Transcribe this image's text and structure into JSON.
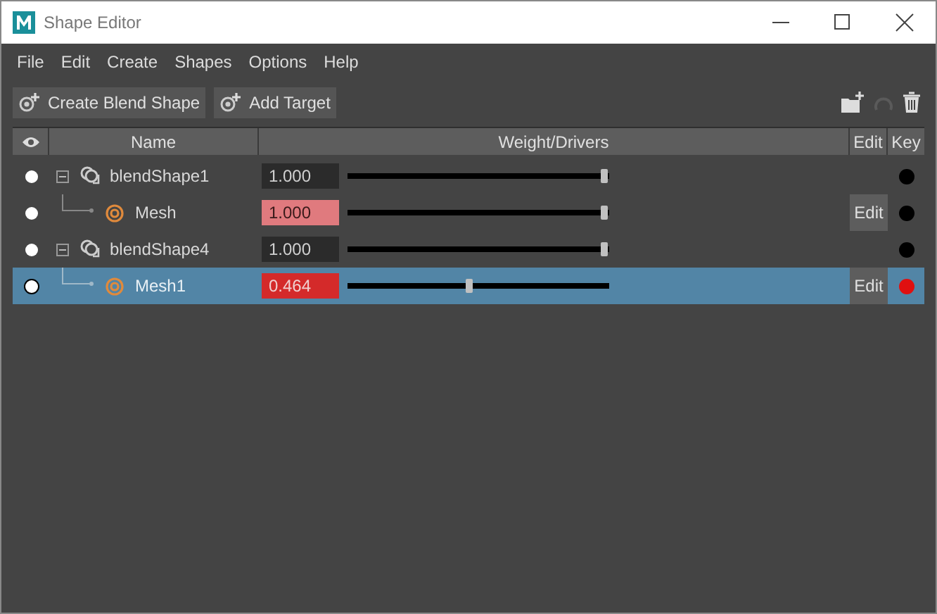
{
  "window": {
    "title": "Shape Editor"
  },
  "menu": [
    "File",
    "Edit",
    "Create",
    "Shapes",
    "Options",
    "Help"
  ],
  "toolbar": {
    "buttons": [
      "Create Blend Shape",
      "Add Target"
    ]
  },
  "table": {
    "columns": [
      "Name",
      "Weight/Drivers",
      "Edit",
      "Key"
    ],
    "rows": [
      {
        "name": "blendShape1",
        "visible": true,
        "expanded": true,
        "selected": false,
        "weight": "1.000",
        "level": 1,
        "keyed": false,
        "key_on_frame": false,
        "children": [
          {
            "name": "Mesh",
            "visible": true,
            "selected": false,
            "weight": "1.000",
            "level": 1,
            "keyed": true,
            "key_on_frame": false,
            "edit": "Edit"
          }
        ]
      },
      {
        "name": "blendShape4",
        "visible": true,
        "expanded": true,
        "selected": false,
        "weight": "1.000",
        "level": 1,
        "keyed": false,
        "key_on_frame": false,
        "children": [
          {
            "name": "Mesh1",
            "visible": true,
            "selected": true,
            "weight": "0.464",
            "level": 0.464,
            "keyed": true,
            "key_on_frame": true,
            "edit": "Edit"
          }
        ]
      }
    ]
  }
}
